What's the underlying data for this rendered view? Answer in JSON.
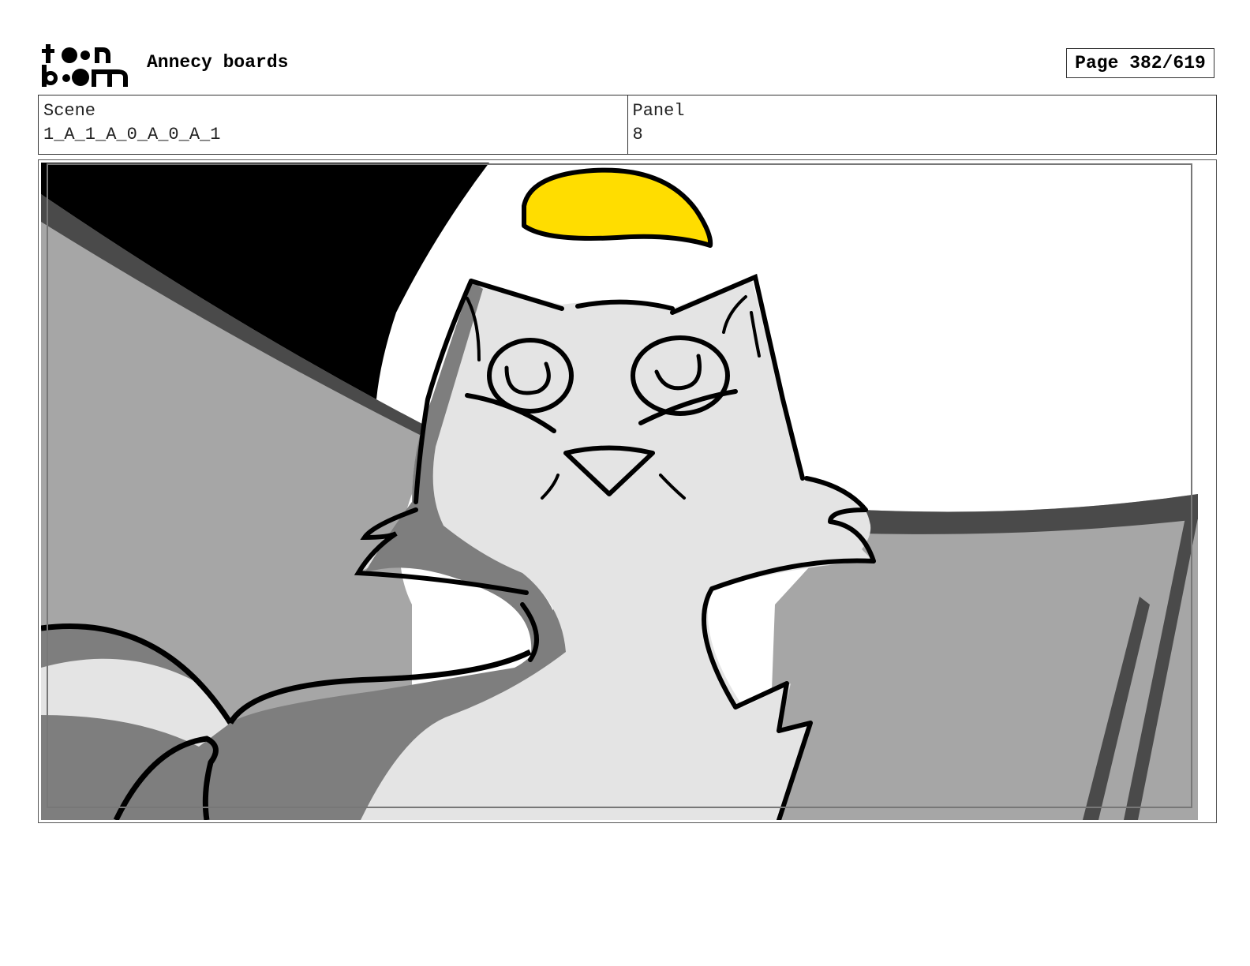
{
  "header": {
    "logo_text_top": "toon",
    "logo_text_bottom": "boom",
    "title": "Annecy boards",
    "page_label": "Page 382/619"
  },
  "info": {
    "scene_label": "Scene",
    "scene_value": "1_A_1_A_0_A_0_A_1",
    "panel_label": "Panel",
    "panel_value": "8"
  },
  "colors": {
    "accent_yellow": "#FFDD00",
    "light_grey": "#E4E4E4",
    "mid_grey": "#A6A6A6",
    "dark_grey": "#4A4A4A",
    "black": "#000000"
  }
}
